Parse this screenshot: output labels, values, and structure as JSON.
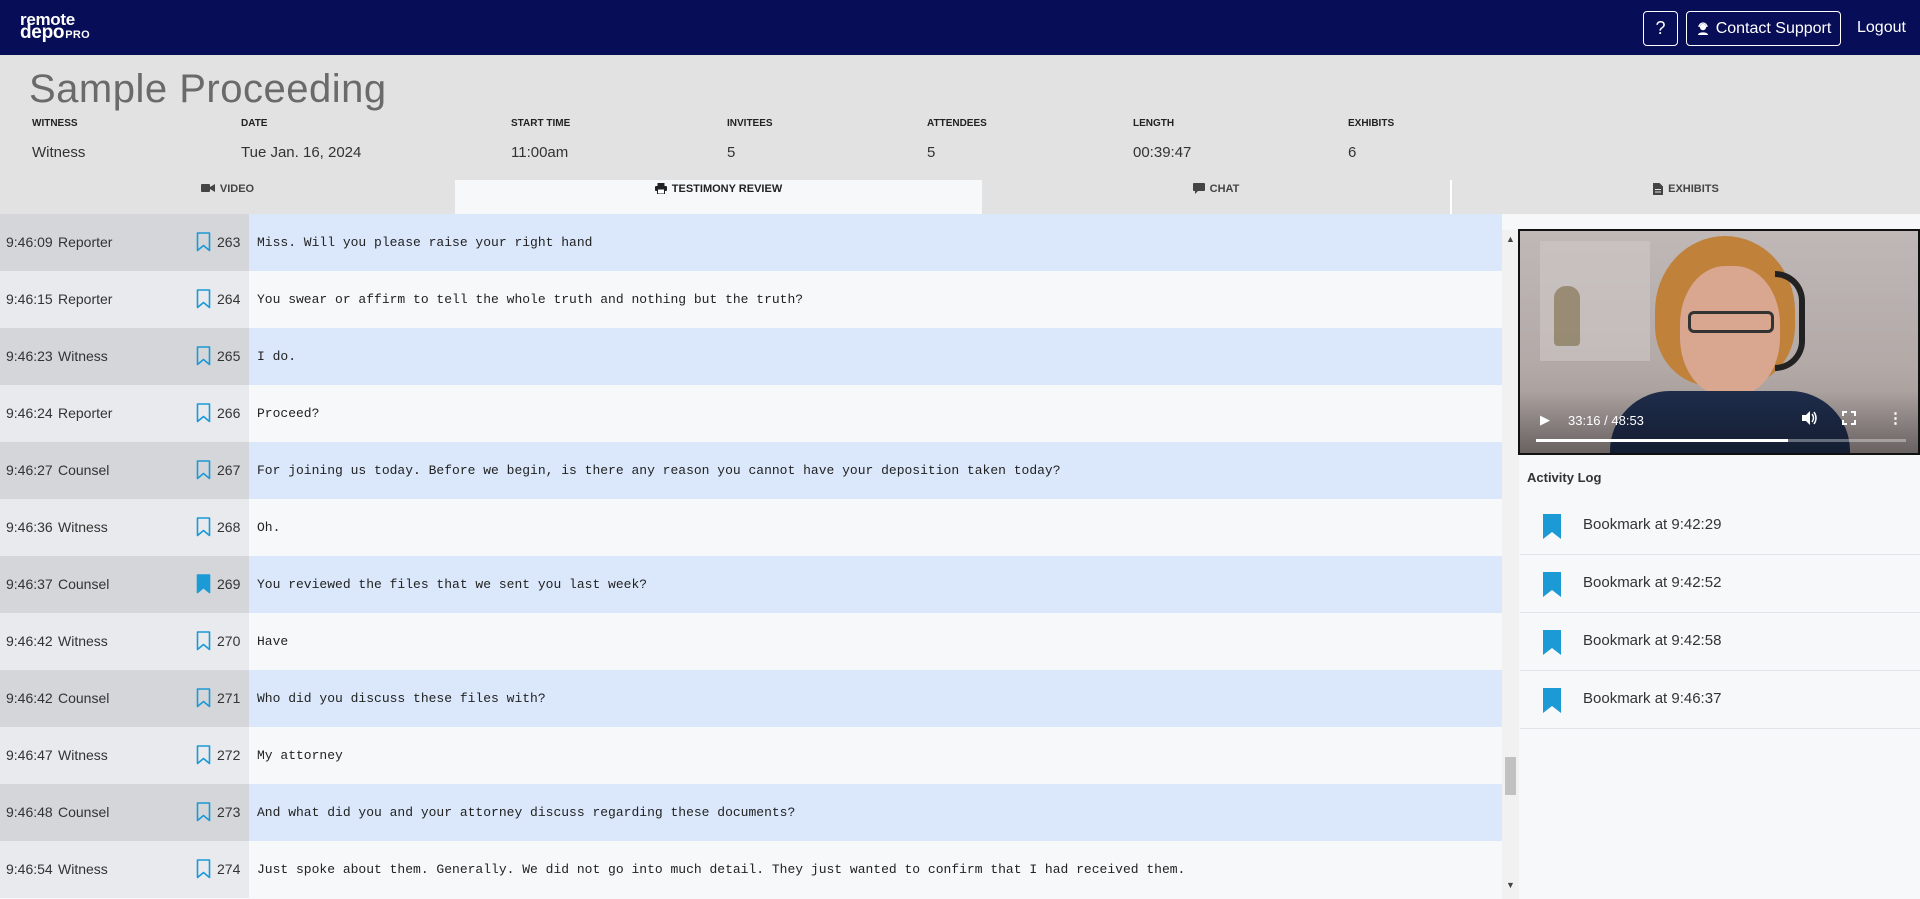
{
  "app": {
    "logo_line1": "remote",
    "logo_line2": "depo",
    "logo_pro": "PRO",
    "help_label": "?",
    "support_label": "Contact Support",
    "logout_label": "Logout"
  },
  "proceeding": {
    "title": "Sample Proceeding",
    "meta": [
      {
        "label": "WITNESS",
        "value": "Witness"
      },
      {
        "label": "DATE",
        "value": "Tue Jan. 16, 2024"
      },
      {
        "label": "START TIME",
        "value": "11:00am"
      },
      {
        "label": "INVITEES",
        "value": "5"
      },
      {
        "label": "ATTENDEES",
        "value": "5"
      },
      {
        "label": "LENGTH",
        "value": "00:39:47"
      },
      {
        "label": "EXHIBITS",
        "value": "6"
      }
    ]
  },
  "tabs": [
    {
      "label": "VIDEO",
      "icon": "video-camera-icon",
      "active": false
    },
    {
      "label": "TESTIMONY REVIEW",
      "icon": "printer-icon",
      "active": true
    },
    {
      "label": "CHAT",
      "icon": "chat-bubble-icon",
      "active": false
    },
    {
      "label": "EXHIBITS",
      "icon": "document-icon",
      "active": false
    }
  ],
  "transcript": [
    {
      "time": "9:46:09",
      "speaker": "Reporter",
      "line": "263",
      "text": "Miss. Will you please raise your right hand",
      "bookmarked": false
    },
    {
      "time": "9:46:15",
      "speaker": "Reporter",
      "line": "264",
      "text": "You swear or affirm to tell the whole truth and nothing but the truth?",
      "bookmarked": false
    },
    {
      "time": "9:46:23",
      "speaker": "Witness",
      "line": "265",
      "text": "I do.",
      "bookmarked": false
    },
    {
      "time": "9:46:24",
      "speaker": "Reporter",
      "line": "266",
      "text": "Proceed?",
      "bookmarked": false
    },
    {
      "time": "9:46:27",
      "speaker": "Counsel",
      "line": "267",
      "text": "For joining us today. Before we begin, is there any reason you cannot have your deposition taken today?",
      "bookmarked": false
    },
    {
      "time": "9:46:36",
      "speaker": "Witness",
      "line": "268",
      "text": "Oh.",
      "bookmarked": false
    },
    {
      "time": "9:46:37",
      "speaker": "Counsel",
      "line": "269",
      "text": "You reviewed the files that we sent you last week?",
      "bookmarked": true
    },
    {
      "time": "9:46:42",
      "speaker": "Witness",
      "line": "270",
      "text": "Have",
      "bookmarked": false
    },
    {
      "time": "9:46:42",
      "speaker": "Counsel",
      "line": "271",
      "text": "Who did you discuss these files with?",
      "bookmarked": false
    },
    {
      "time": "9:46:47",
      "speaker": "Witness",
      "line": "272",
      "text": "My attorney",
      "bookmarked": false
    },
    {
      "time": "9:46:48",
      "speaker": "Counsel",
      "line": "273",
      "text": "And what did you and your attorney discuss regarding these documents?",
      "bookmarked": false
    },
    {
      "time": "9:46:54",
      "speaker": "Witness",
      "line": "274",
      "text": "Just spoke about them. Generally. We did not go into much detail. They just wanted to confirm that I had received them.",
      "bookmarked": false
    }
  ],
  "video": {
    "time_display": "33:16 / 48:53",
    "progress": 0.68
  },
  "activity_log": {
    "title": "Activity Log",
    "items": [
      {
        "label": "Bookmark at 9:42:29",
        "icon": "bookmark-icon"
      },
      {
        "label": "Bookmark at 9:42:52",
        "icon": "bookmark-icon"
      },
      {
        "label": "Bookmark at 9:42:58",
        "icon": "bookmark-icon"
      },
      {
        "label": "Bookmark at 9:46:37",
        "icon": "bookmark-icon"
      }
    ]
  },
  "colors": {
    "topbar": "#070d56",
    "bookmark_blue": "#1b9ad6",
    "row_highlight": "#dbe8fb"
  }
}
